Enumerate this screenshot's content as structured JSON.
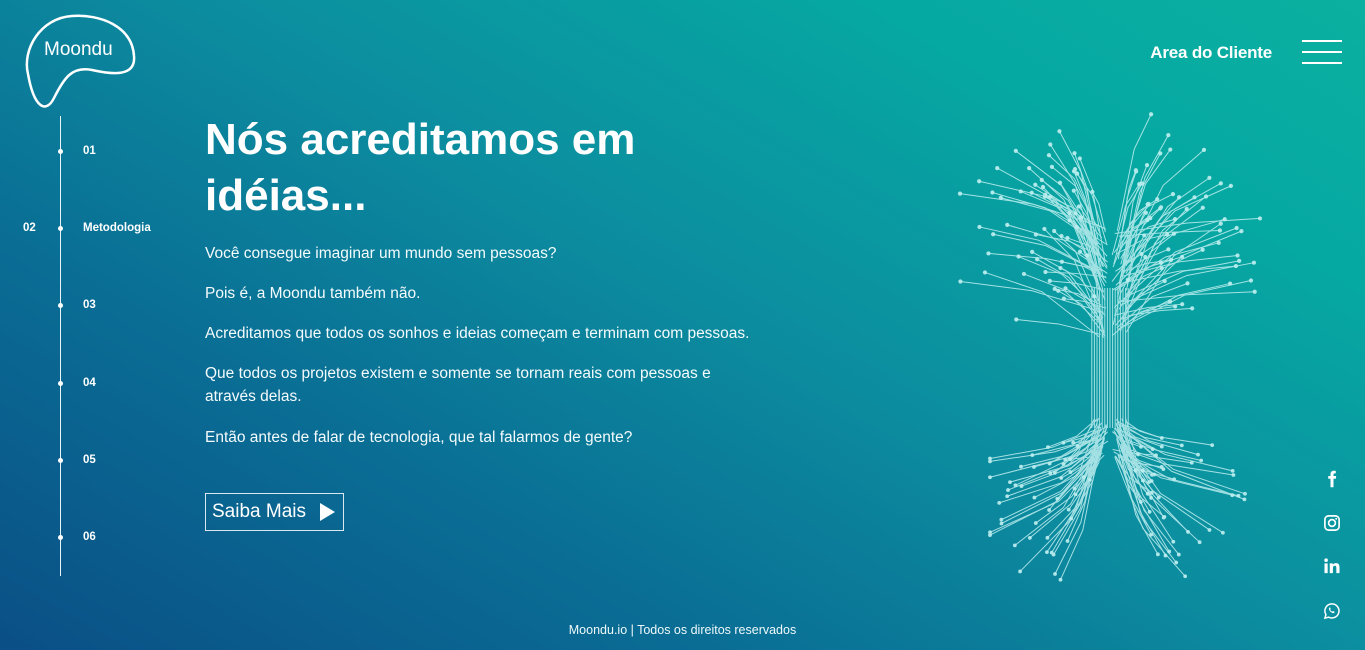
{
  "brand": {
    "name": "Moondu"
  },
  "header": {
    "client_area": "Area do Cliente",
    "menu_icon": "hamburger-icon"
  },
  "timeline": {
    "steps": [
      {
        "number": "01",
        "label": ""
      },
      {
        "number": "02",
        "label": "Metodologia",
        "active": true
      },
      {
        "number": "03",
        "label": ""
      },
      {
        "number": "04",
        "label": ""
      },
      {
        "number": "05",
        "label": ""
      },
      {
        "number": "06",
        "label": ""
      }
    ]
  },
  "main": {
    "title_line1": "Nós acreditamos em",
    "title_line2": "idéias...",
    "paragraphs": [
      "Você consegue imaginar um mundo sem pessoas?",
      "Pois é, a Moondu também não.",
      "Acreditamos que todos os sonhos e ideias começam e terminam com pessoas.",
      "Que todos os projetos existem e somente se tornam reais com pessoas e através delas.",
      "Então antes de falar de tecnologia, que tal falarmos de gente?"
    ],
    "cta_label": "Saiba Mais",
    "cta_icon": "play-icon"
  },
  "social": [
    "facebook-icon",
    "instagram-icon",
    "linkedin-icon",
    "whatsapp-icon"
  ],
  "footer": {
    "text": "Moondu.io | Todos os direitos reservados"
  },
  "colors": {
    "gradient_start": "#0a4f86",
    "gradient_end": "#0bb0a0",
    "circuit": "#bfeff0"
  }
}
